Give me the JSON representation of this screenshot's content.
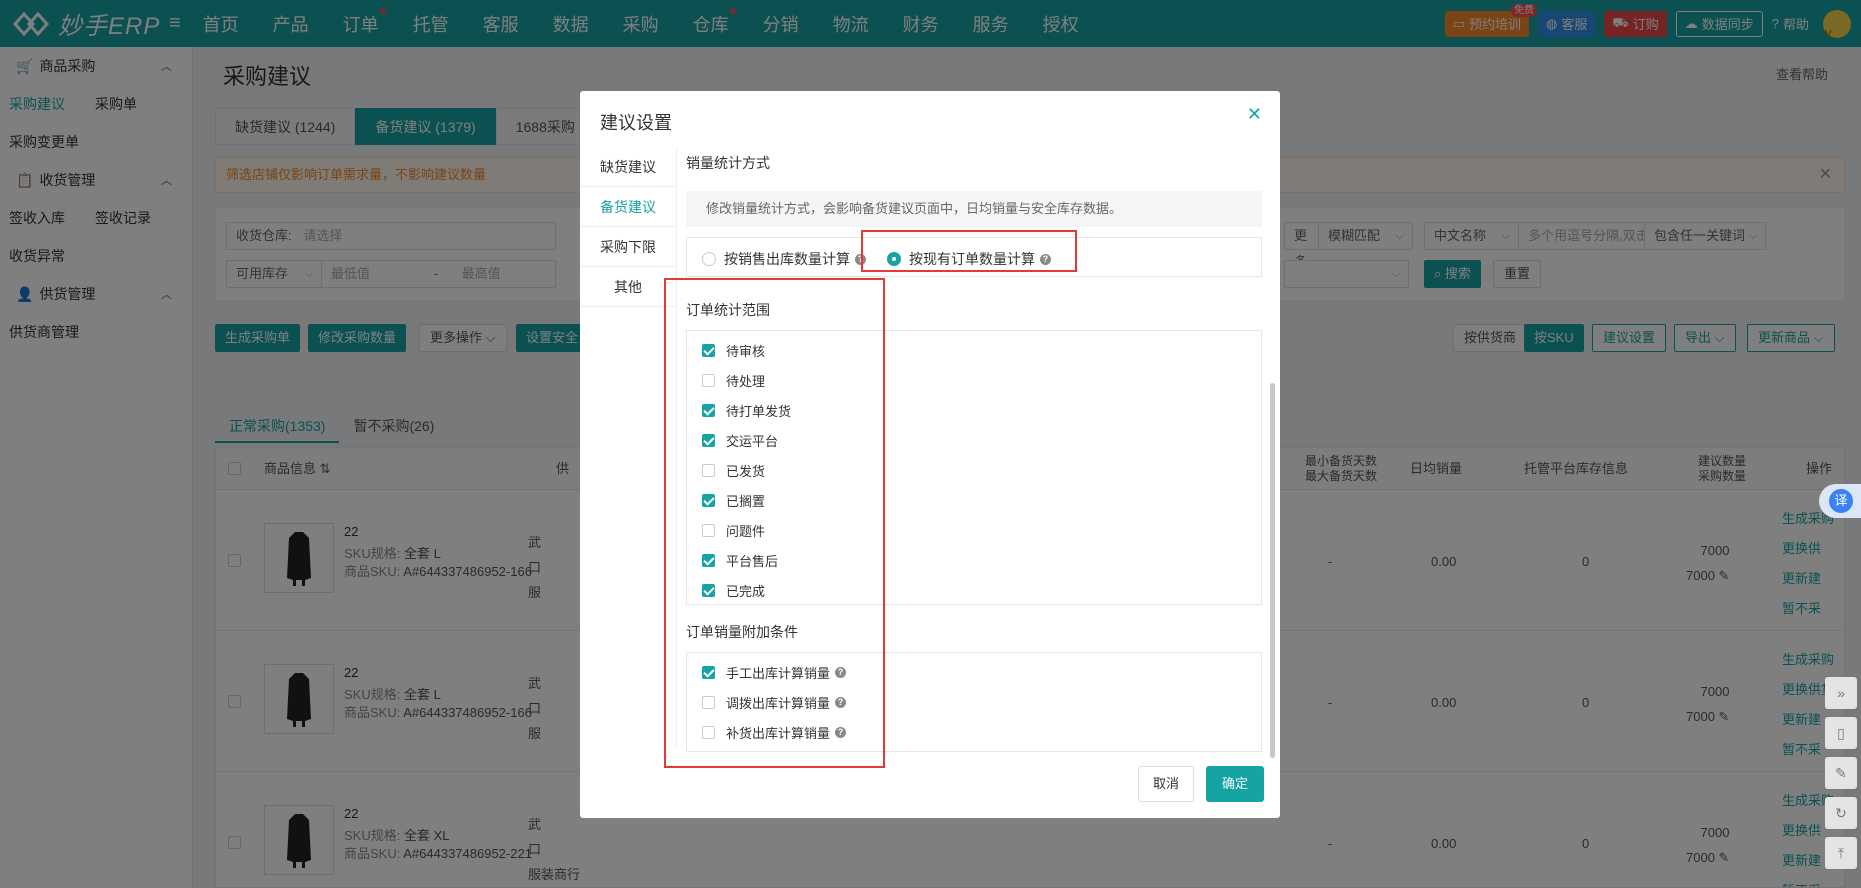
{
  "app": {
    "logo_text": "妙手ERP",
    "nav": [
      {
        "label": "首页",
        "dot": false
      },
      {
        "label": "产品",
        "dot": false
      },
      {
        "label": "订单",
        "dot": true
      },
      {
        "label": "托管",
        "dot": false
      },
      {
        "label": "客服",
        "dot": false
      },
      {
        "label": "数据",
        "dot": false
      },
      {
        "label": "采购",
        "dot": false
      },
      {
        "label": "仓库",
        "dot": true
      },
      {
        "label": "分销",
        "dot": false
      },
      {
        "label": "物流",
        "dot": false
      },
      {
        "label": "财务",
        "dot": false
      },
      {
        "label": "服务",
        "dot": false
      },
      {
        "label": "授权",
        "dot": false
      }
    ],
    "top_buttons": {
      "training": "预约培训",
      "training_badge": "免费",
      "service": "客服",
      "order": "订购",
      "sync": "数据同步",
      "help": "帮助"
    },
    "colors": {
      "brand": "#16a3a3",
      "warn": "#f5892a",
      "highlight": "#e53935"
    }
  },
  "sidebar": {
    "groups": [
      {
        "title": "商品采购",
        "icon": "cart-icon",
        "items": [
          "采购建议",
          "采购单",
          "采购变更单"
        ],
        "active": "采购建议"
      },
      {
        "title": "收货管理",
        "icon": "clipboard-icon",
        "items": [
          "签收入库",
          "签收记录",
          "收货异常"
        ]
      },
      {
        "title": "供货管理",
        "icon": "user-icon",
        "items": [
          "供货商管理"
        ]
      }
    ]
  },
  "page": {
    "title": "采购建议",
    "help_link": "查看帮助",
    "tabs": [
      "缺货建议 (1244)",
      "备货建议 (1379)",
      "1688采购"
    ],
    "active_tab": 1,
    "warning": "筛选店铺仅影响订单需求量，不影响建议数量",
    "filters": {
      "warehouse_label": "收货仓库:",
      "warehouse_placeholder": "请选择",
      "stock_select": "可用库存",
      "min_placeholder": "最低值",
      "dash": "-",
      "max_placeholder": "最高值",
      "more": "更多",
      "match_mode": "模糊匹配",
      "name_select": "中文名称",
      "multi_placeholder": "多个用逗号分隔,双击输入",
      "keyword_mode": "包含任一关键词",
      "search": "搜索",
      "reset": "重置"
    },
    "actions": {
      "generate": "生成采购单",
      "modify_qty": "修改采购数量",
      "more_ops": "更多操作",
      "set_safe": "设置安全",
      "by_supplier": "按供货商",
      "by_sku": "按SKU",
      "settings": "建议设置",
      "export": "导出",
      "update": "更新商品"
    },
    "subtabs": [
      "正常采购(1353)",
      "暂不采购(26)"
    ],
    "table": {
      "headers": {
        "product": "商品信息",
        "supplier": "供",
        "min_days": "最小备货天数",
        "max_days": "最大备货天数",
        "daily": "日均销量",
        "hosted": "托管平台库存信息",
        "sugg_qty": "建议数量",
        "buy_qty": "采购数量",
        "ops": "操作"
      },
      "rows": [
        {
          "id": "22",
          "spec_label": "SKU规格:",
          "spec": "全套 L",
          "sku_label": "商品SKU:",
          "sku": "A#644337486952-166",
          "supplier": [
            "武",
            "口",
            "服"
          ],
          "days": "-",
          "daily": "0.00",
          "hosted": "0",
          "sugg": "7000",
          "buy": "7000",
          "ops": [
            "生成采购",
            "更换供",
            "更新建",
            "暂不采"
          ]
        },
        {
          "id": "22",
          "spec_label": "SKU规格:",
          "spec": "全套 L",
          "sku_label": "商品SKU:",
          "sku": "A#644337486952-166",
          "supplier": [
            "武",
            "口",
            "服"
          ],
          "days": "-",
          "daily": "0.00",
          "hosted": "0",
          "sugg": "7000",
          "buy": "7000",
          "ops": [
            "生成采购",
            "更换供货",
            "更新建",
            "暂不采"
          ]
        },
        {
          "id": "22",
          "spec_label": "SKU规格:",
          "spec": "全套 XL",
          "sku_label": "商品SKU:",
          "sku": "A#644337486952-221",
          "supplier": [
            "武",
            "口",
            "服装商行"
          ],
          "days": "-",
          "daily": "0.00",
          "hosted": "0",
          "sugg": "7000",
          "buy": "7000",
          "ops": [
            "生成采购",
            "更换供",
            "更新建",
            "暂不采"
          ]
        }
      ]
    }
  },
  "modal": {
    "title": "建议设置",
    "nav": [
      "缺货建议",
      "备货建议",
      "采购下限",
      "其他"
    ],
    "active_nav": 1,
    "sales_method": {
      "title": "销量统计方式",
      "info": "修改销量统计方式，会影响备货建议页面中，日均销量与安全库存数据。",
      "options": [
        {
          "label": "按销售出库数量计算",
          "checked": false
        },
        {
          "label": "按现有订单数量计算",
          "checked": true
        }
      ]
    },
    "order_scope": {
      "title": "订单统计范围",
      "items": [
        {
          "label": "待审核",
          "checked": true
        },
        {
          "label": "待处理",
          "checked": false
        },
        {
          "label": "待打单发货",
          "checked": true
        },
        {
          "label": "交运平台",
          "checked": true
        },
        {
          "label": "已发货",
          "checked": false
        },
        {
          "label": "已搁置",
          "checked": true
        },
        {
          "label": "问题件",
          "checked": false
        },
        {
          "label": "平台售后",
          "checked": true
        },
        {
          "label": "已完成",
          "checked": true
        }
      ]
    },
    "extra": {
      "title": "订单销量附加条件",
      "items": [
        {
          "label": "手工出库计算销量",
          "checked": true
        },
        {
          "label": "调拨出库计算销量",
          "checked": false
        },
        {
          "label": "补货出库计算销量",
          "checked": false
        }
      ]
    },
    "cancel": "取消",
    "confirm": "确定"
  },
  "misc": {
    "translate": "译"
  }
}
